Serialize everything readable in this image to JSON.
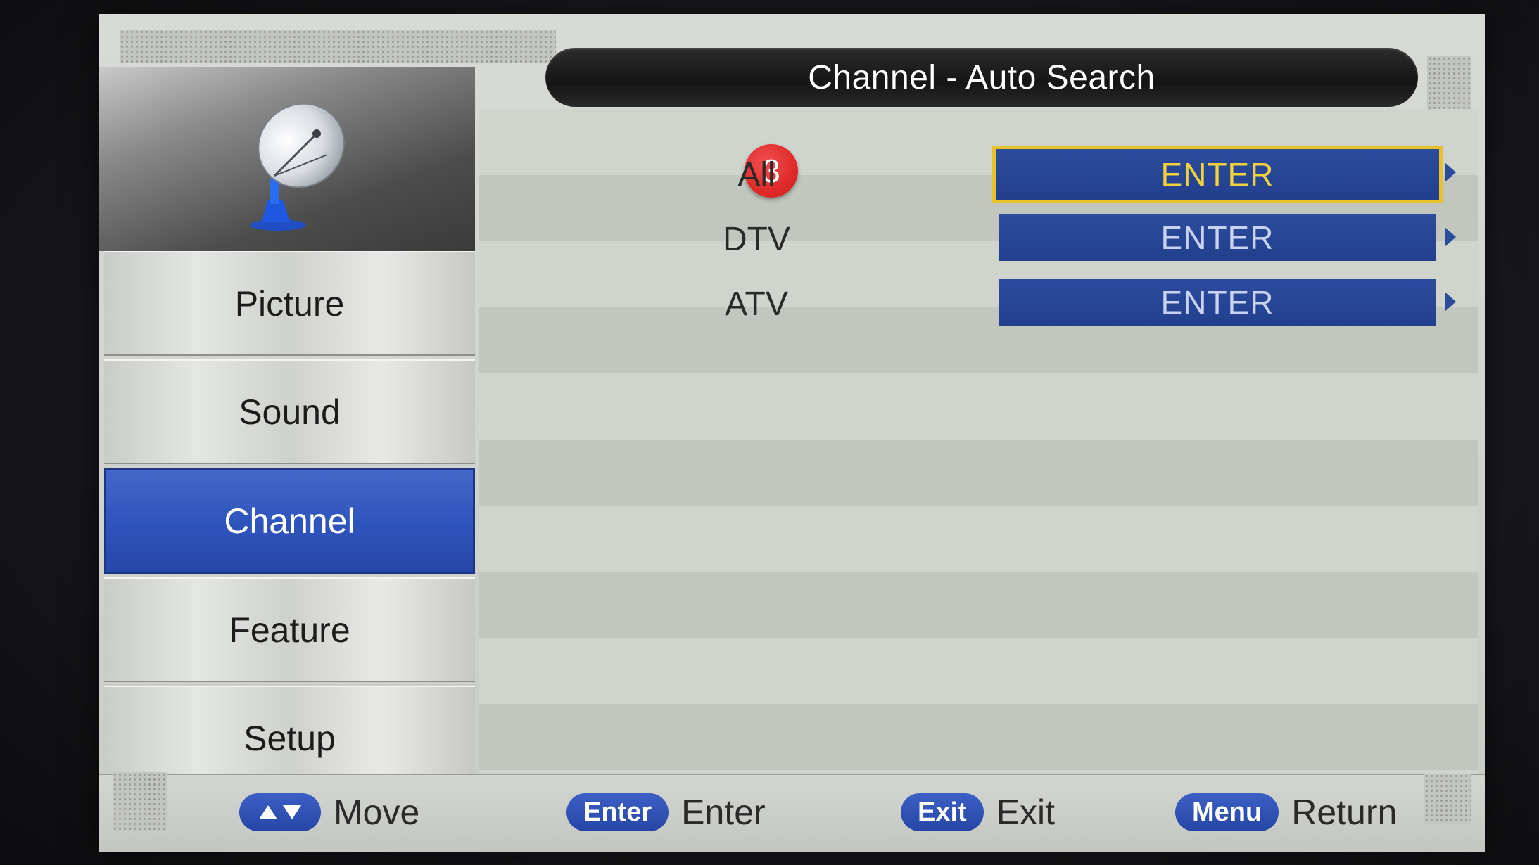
{
  "window": {
    "title": "Channel - Auto Search"
  },
  "sidebar": {
    "icon": "satellite-dish-icon",
    "items": [
      {
        "label": "Picture",
        "active": false
      },
      {
        "label": "Sound",
        "active": false
      },
      {
        "label": "Channel",
        "active": true
      },
      {
        "label": "Feature",
        "active": false
      },
      {
        "label": "Setup",
        "active": false
      }
    ]
  },
  "content": {
    "step_badge": "3",
    "rows": [
      {
        "label": "All",
        "button": "ENTER",
        "selected": true
      },
      {
        "label": "DTV",
        "button": "ENTER",
        "selected": false
      },
      {
        "label": "ATV",
        "button": "ENTER",
        "selected": false
      }
    ]
  },
  "footer": {
    "move_key_icon": "up-down-arrows-icon",
    "move_label": "Move",
    "enter_key": "Enter",
    "enter_label": "Enter",
    "exit_key": "Exit",
    "exit_label": "Exit",
    "menu_key": "Menu",
    "menu_label": "Return"
  },
  "colors": {
    "accent_blue": "#2f55be",
    "button_blue": "#213f8c",
    "selection_yellow": "#e8c22a",
    "badge_red": "#e02a2a",
    "title_bar": "#151515"
  }
}
